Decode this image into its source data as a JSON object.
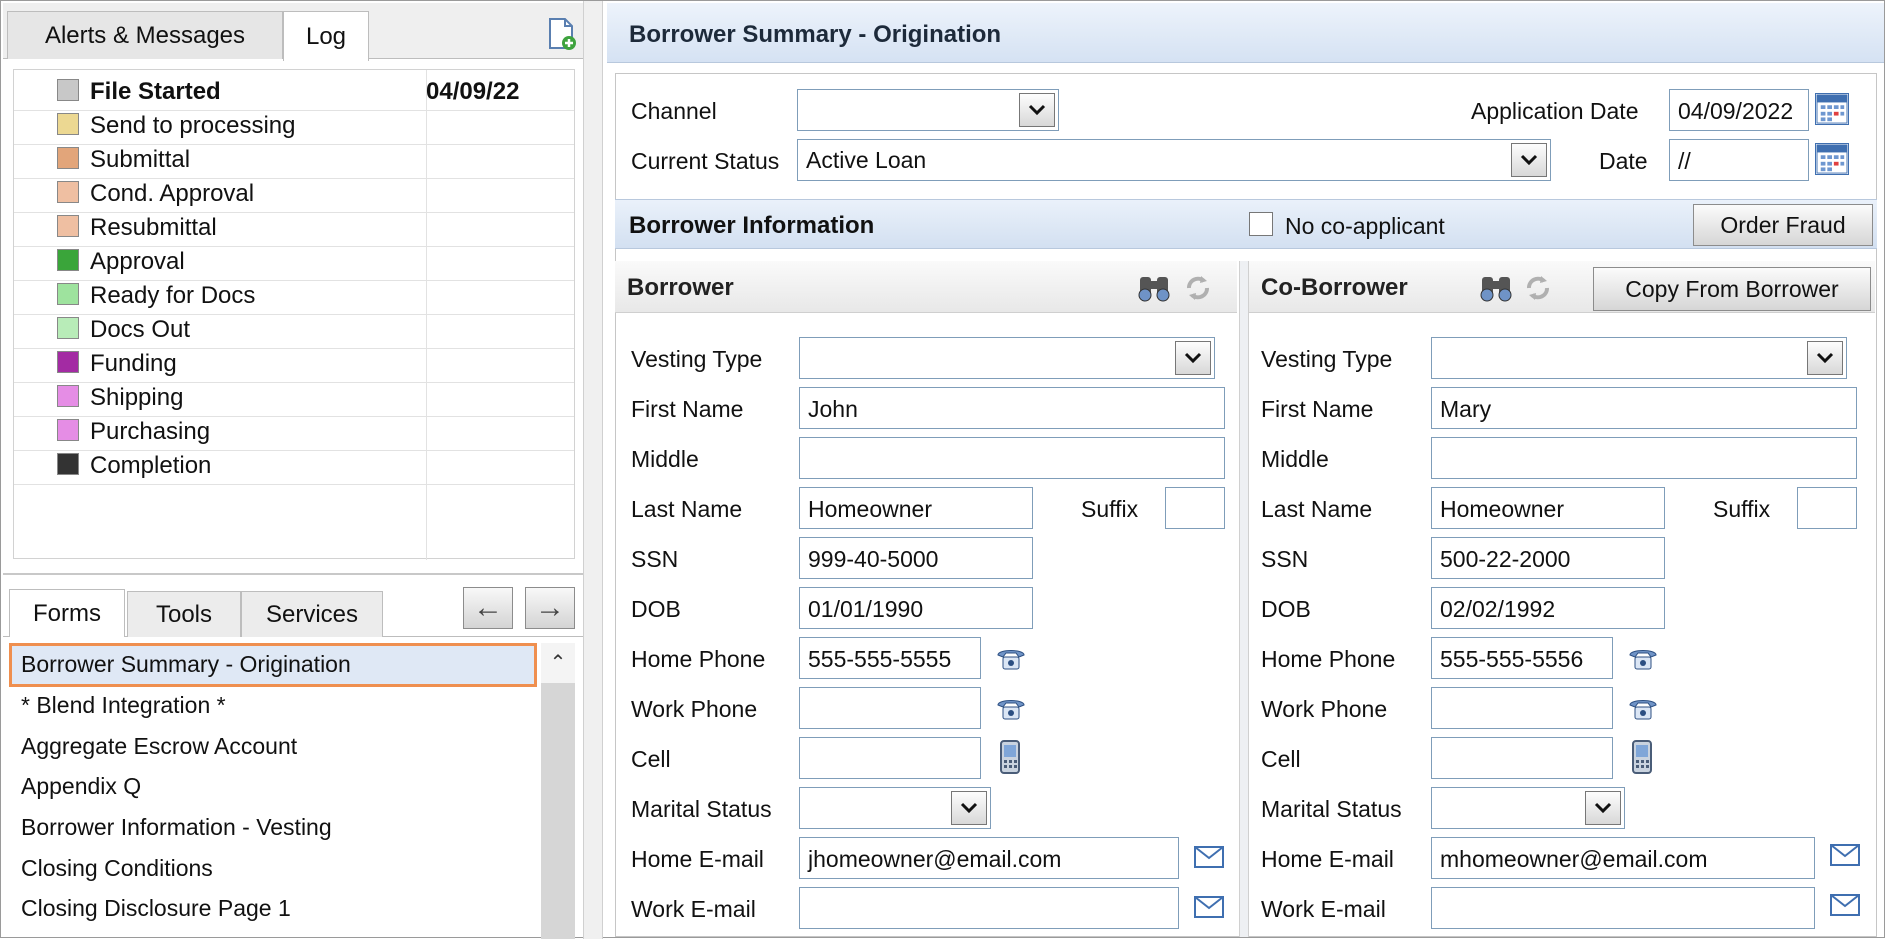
{
  "left_panel": {
    "top_tabs": [
      "Alerts & Messages",
      "Log"
    ],
    "log_date": "04/09/22",
    "log_items": [
      {
        "label": "File Started",
        "color": "#c8c8c8",
        "bold": true
      },
      {
        "label": "Send to processing",
        "color": "#ecd892"
      },
      {
        "label": "Submittal",
        "color": "#e2a57a"
      },
      {
        "label": "Cond. Approval",
        "color": "#efbfa2"
      },
      {
        "label": "Resubmittal",
        "color": "#efbfa2"
      },
      {
        "label": "Approval",
        "color": "#3aa53a"
      },
      {
        "label": "Ready for Docs",
        "color": "#9ee39e"
      },
      {
        "label": "Docs Out",
        "color": "#b8ecb8"
      },
      {
        "label": "Funding",
        "color": "#a32ba3"
      },
      {
        "label": "Shipping",
        "color": "#e58de5"
      },
      {
        "label": "Purchasing",
        "color": "#e58de5"
      },
      {
        "label": "Completion",
        "color": "#333333"
      }
    ],
    "bottom_tabs": [
      "Forms",
      "Tools",
      "Services"
    ],
    "forms": [
      "Borrower Summary - Origination",
      "* Blend Integration *",
      "Aggregate Escrow Account",
      "Appendix Q",
      "Borrower Information - Vesting",
      "Closing Conditions",
      "Closing Disclosure Page 1"
    ]
  },
  "main": {
    "title": "Borrower Summary - Origination",
    "channel_label": "Channel",
    "channel_value": "",
    "current_status_label": "Current Status",
    "current_status_value": "Active Loan",
    "application_date_label": "Application Date",
    "application_date_value": "04/09/2022",
    "date_label": "Date",
    "date_value": "//",
    "borrower_info_title": "Borrower Information",
    "no_coapplicant_label": "No co-applicant",
    "order_fraud_label": "Order Fraud",
    "copy_from_borrower_label": "Copy From Borrower"
  },
  "labels": {
    "vesting_type": "Vesting Type",
    "first_name": "First Name",
    "middle": "Middle",
    "last_name": "Last Name",
    "suffix": "Suffix",
    "ssn": "SSN",
    "dob": "DOB",
    "home_phone": "Home Phone",
    "work_phone": "Work Phone",
    "cell": "Cell",
    "marital_status": "Marital Status",
    "home_email": "Home E-mail",
    "work_email": "Work E-mail"
  },
  "borrower": {
    "title": "Borrower",
    "vesting_type": "",
    "first_name": "John",
    "middle": "",
    "last_name": "Homeowner",
    "suffix": "",
    "ssn": "999-40-5000",
    "dob": "01/01/1990",
    "home_phone": "555-555-5555",
    "work_phone": "",
    "cell": "",
    "marital_status": "",
    "home_email": "jhomeowner@email.com",
    "work_email": ""
  },
  "coborrower": {
    "title": "Co-Borrower",
    "vesting_type": "",
    "first_name": "Mary",
    "middle": "",
    "last_name": "Homeowner",
    "suffix": "",
    "ssn": "500-22-2000",
    "dob": "02/02/1992",
    "home_phone": "555-555-5556",
    "work_phone": "",
    "cell": "",
    "marital_status": "",
    "home_email": "mhomeowner@email.com",
    "work_email": ""
  },
  "colors": {
    "header_blue": "#d5e2f3",
    "field_border": "#7f9db9",
    "selection_orange": "#ef8f4f"
  },
  "icons": [
    "new-document-icon",
    "arrow-left-icon",
    "arrow-right-icon",
    "calendar-icon",
    "binoculars-icon",
    "refresh-icon",
    "phone-icon",
    "cellphone-icon",
    "envelope-icon",
    "chevron-down-icon",
    "chevron-up-icon"
  ]
}
